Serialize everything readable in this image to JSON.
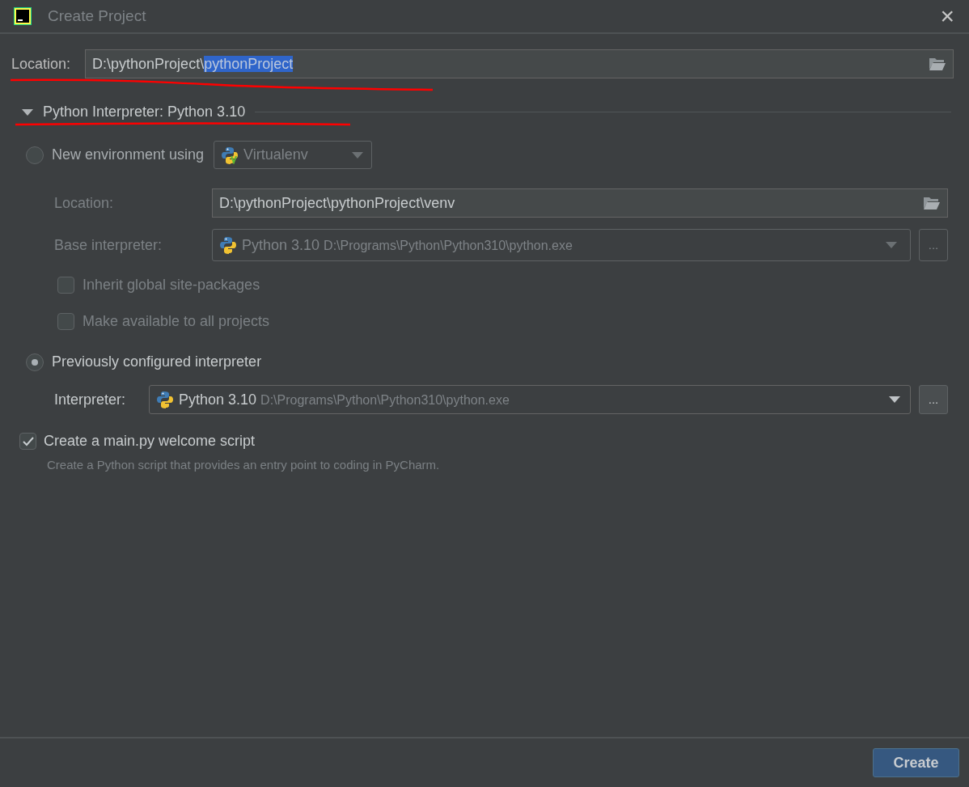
{
  "window": {
    "title": "Create Project",
    "close": "×"
  },
  "location": {
    "label": "Location:",
    "value_parts": [
      {
        "text": "D:\\pythonProject\\",
        "selected": false
      },
      {
        "text": "pythonProject",
        "selected": true
      }
    ]
  },
  "interpreter_section": {
    "title": "Python Interpreter: Python 3.10",
    "expanded": true,
    "options": [
      {
        "kind": "new",
        "label": "New environment using",
        "selected": false,
        "tool": "Virtualenv",
        "disabled": true,
        "location": {
          "label": "Location:",
          "value": "D:\\pythonProject\\pythonProject\\venv"
        },
        "base_interpreter": {
          "label": "Base interpreter:",
          "name": "Python 3.10",
          "path": "D:\\Programs\\Python\\Python310\\python.exe",
          "more": "..."
        },
        "checkboxes": [
          {
            "label": "Inherit global site-packages",
            "checked": false
          },
          {
            "label": "Make available to all projects",
            "checked": false
          }
        ]
      },
      {
        "kind": "existing",
        "label": "Previously configured interpreter",
        "selected": true,
        "disabled": false,
        "interpreter": {
          "label": "Interpreter:",
          "name": "Python 3.10",
          "path": "D:\\Programs\\Python\\Python310\\python.exe",
          "more": "..."
        }
      }
    ]
  },
  "welcome_script": {
    "label": "Create a main.py welcome script",
    "checked": true,
    "description": "Create a Python script that provides an entry point to coding in PyCharm."
  },
  "buttons": [
    {
      "label": "Create",
      "kind": "primary"
    }
  ]
}
